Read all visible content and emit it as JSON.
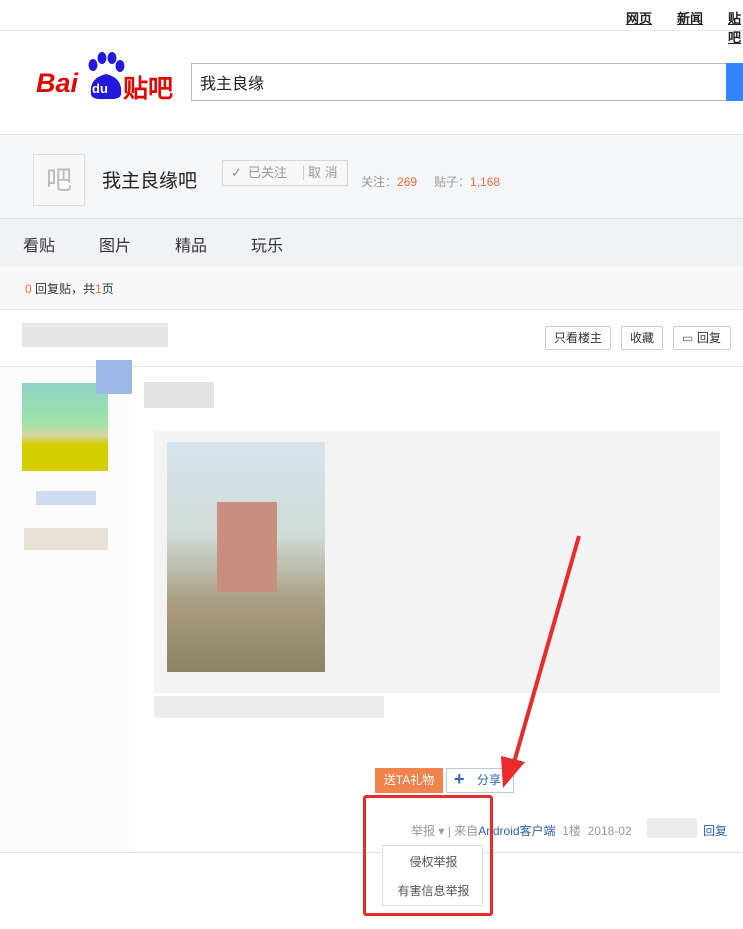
{
  "top_nav": {
    "links": [
      "网页",
      "新闻",
      "贴吧"
    ]
  },
  "logo": {
    "text_bai": "Bai",
    "text_du": "du",
    "text_tieba": "贴吧"
  },
  "search": {
    "value": "我主良缘"
  },
  "forum": {
    "avatar_char": "吧",
    "name": "我主良缘吧",
    "follow_check": "✓",
    "followed_label": "已关注",
    "cancel_label": "取 消",
    "follow_label": "关注：",
    "follow_count": "269",
    "posts_label": "贴子：",
    "posts_count": "1,168"
  },
  "tabs": [
    "看贴",
    "图片",
    "精品",
    "玩乐"
  ],
  "reply_info": {
    "count": "0",
    "text_mid": " 回复贴，共",
    "pages": "1",
    "text_end": "页"
  },
  "thread_buttons": {
    "only_op": "只看楼主",
    "collect": "收藏",
    "reply": "回复"
  },
  "post": {
    "gift_label": "送TA礼物",
    "share_label": "分享",
    "report_label": "举报",
    "report_caret": "▾",
    "from_prefix": "| 来自",
    "client_label": "Android客户端",
    "floor": "1楼",
    "date": "2018-02",
    "reply_label": "回复"
  },
  "report_menu": {
    "items": [
      "侵权举报",
      "有害信息举报"
    ]
  },
  "colors": {
    "accent_orange": "#f56c3b",
    "link_blue": "#2d64b3",
    "annotation_red": "#e82b2b",
    "search_blue": "#3385ff"
  }
}
